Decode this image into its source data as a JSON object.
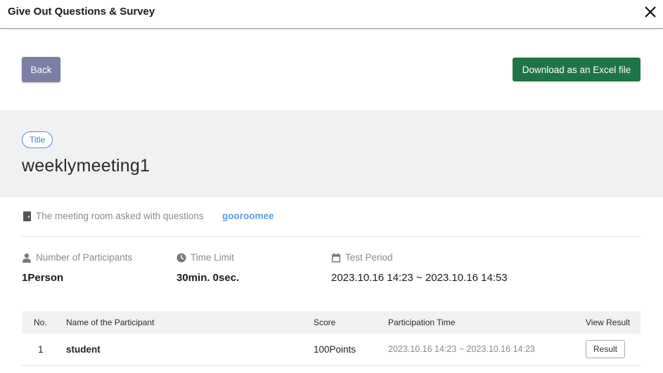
{
  "dialog": {
    "title": "Give Out Questions & Survey"
  },
  "toolbar": {
    "back_label": "Back",
    "excel_label": "Download as an Excel file"
  },
  "survey": {
    "badge": "Title",
    "title": "weeklymeeting1"
  },
  "room": {
    "label": "The meeting room asked with questions",
    "value": "gooroomee"
  },
  "stats": {
    "participants_label": "Number of Participants",
    "participants_value": "1Person",
    "time_limit_label": "Time Limit",
    "time_limit_value": "30min. 0sec.",
    "period_label": "Test Period",
    "period_value": "2023.10.16 14:23 ~ 2023.10.16 14:53"
  },
  "table": {
    "headers": {
      "no": "No.",
      "name": "Name of the Participant",
      "score": "Score",
      "time": "Participation Time",
      "view": "View Result"
    },
    "rows": [
      {
        "no": "1",
        "name": "student",
        "score": "100Points",
        "time": "2023.10.16 14:23 ~ 2023.10.16 14:23",
        "button": "Result"
      }
    ]
  },
  "colors": {
    "back_button": "#7b7fa3",
    "excel_button": "#1e7444",
    "badge_border": "#4a90e2",
    "room_link": "#5a9ee0",
    "section_bg": "#f0f1f3"
  }
}
